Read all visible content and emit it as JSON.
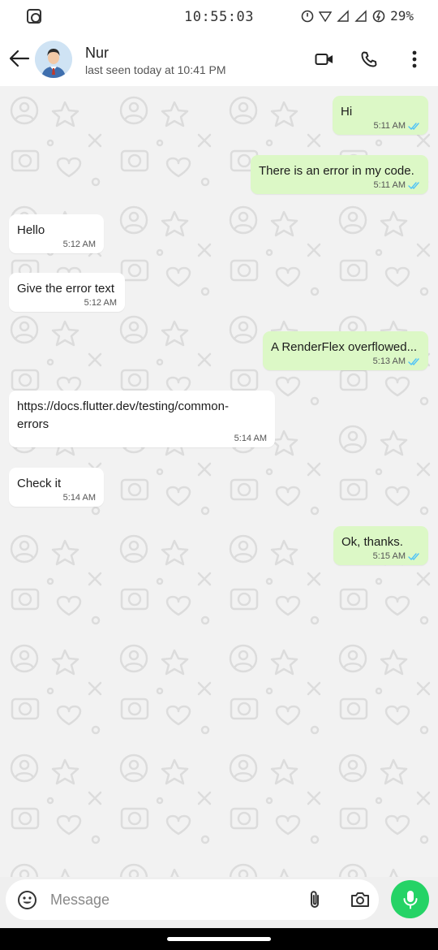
{
  "status_bar": {
    "time": "10:55:03",
    "battery": "29%"
  },
  "header": {
    "contact_name": "Nur",
    "last_seen": "last seen today at 10:41 PM"
  },
  "messages": [
    {
      "direction": "out",
      "text": "Hi",
      "time": "5:11 AM",
      "read": true
    },
    {
      "direction": "out",
      "text": "There is an error in my code.",
      "time": "5:11 AM",
      "read": true
    },
    {
      "direction": "in",
      "text": "Hello",
      "time": "5:12 AM"
    },
    {
      "direction": "in",
      "text": "Give the error text",
      "time": "5:12 AM"
    },
    {
      "direction": "out",
      "text": "A RenderFlex overflowed...",
      "time": "5:13 AM",
      "read": true
    },
    {
      "direction": "in",
      "text": "https://docs.flutter.dev/testing/common-\nerrors",
      "time": "5:14 AM"
    },
    {
      "direction": "in",
      "text": "Check it",
      "time": "5:14 AM"
    },
    {
      "direction": "out",
      "text": "Ok, thanks.",
      "time": "5:15 AM",
      "read": true
    }
  ],
  "input": {
    "placeholder": "Message"
  },
  "icons": {
    "back": "arrow-left-icon",
    "video": "video-camera-icon",
    "call": "phone-icon",
    "menu": "more-vertical-icon",
    "emoji": "emoji-icon",
    "attach": "paperclip-icon",
    "camera": "camera-icon",
    "mic": "microphone-icon"
  },
  "colors": {
    "outgoing_bubble": "#dcf8c6",
    "incoming_bubble": "#ffffff",
    "read_ticks": "#4fc3f7",
    "mic_button": "#25d366"
  }
}
